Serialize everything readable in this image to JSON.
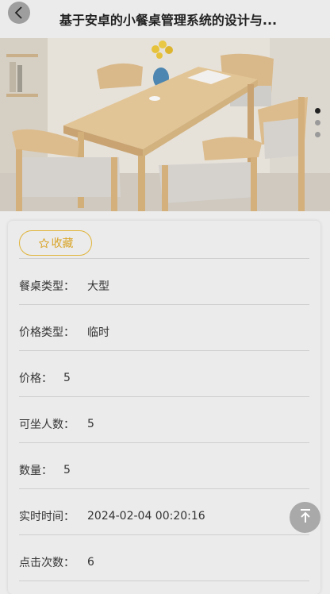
{
  "header": {
    "title": "基于安卓的小餐桌管理系统的设计与...",
    "back_icon": "chevron-left-icon"
  },
  "banner": {
    "image_description_icon": "dining-table-photo",
    "slide_count": 3,
    "active_slide": 1
  },
  "detail": {
    "favorite_label": "收藏",
    "favorite_icon": "star-outline-icon",
    "accent_color": "#d9a52a",
    "fields": [
      {
        "label": "餐桌类型：",
        "value": "大型"
      },
      {
        "label": "价格类型：",
        "value": "临时"
      },
      {
        "label": "价格：",
        "value": "5"
      },
      {
        "label": "可坐人数：",
        "value": "5"
      },
      {
        "label": "数量：",
        "value": "5"
      },
      {
        "label": "实时时间：",
        "value": "2024-02-04 00:20:16"
      },
      {
        "label": "点击次数：",
        "value": "6"
      }
    ]
  },
  "back_to_top_icon": "arrow-up-to-top-icon"
}
